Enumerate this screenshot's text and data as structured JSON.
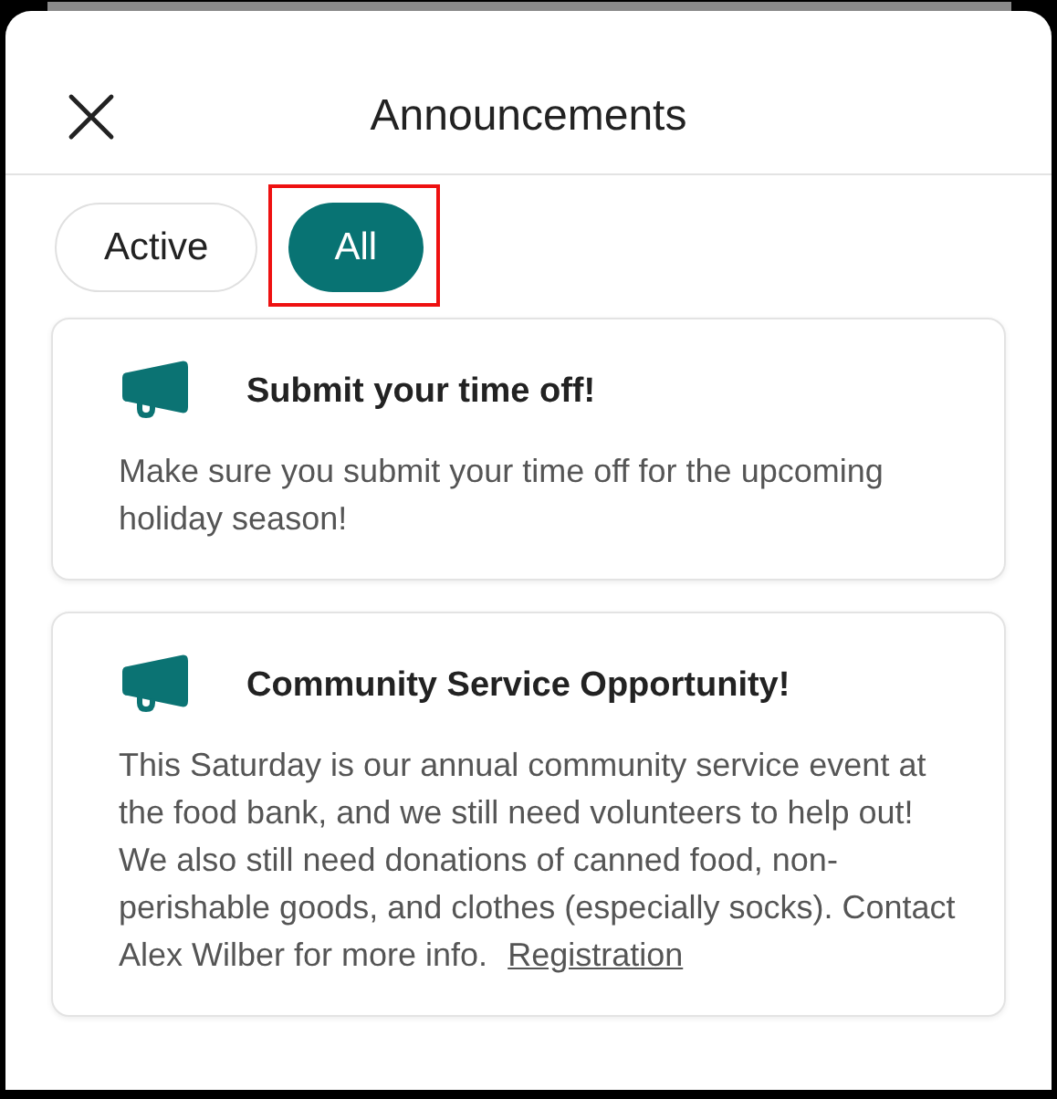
{
  "header": {
    "title": "Announcements"
  },
  "tabs": [
    {
      "label": "Active",
      "selected": false
    },
    {
      "label": "All",
      "selected": true
    }
  ],
  "announcements": [
    {
      "title": "Submit your time off!",
      "body": "Make sure you submit your time off for the upcoming holiday season!"
    },
    {
      "title": "Community Service Opportunity!",
      "body": "This Saturday is our annual community service event at the food bank, and we still need volunteers to help out! We also still need donations of canned food, non-perishable goods, and clothes (especially socks). Contact Alex Wilber for more info.",
      "link": "Registration"
    }
  ]
}
